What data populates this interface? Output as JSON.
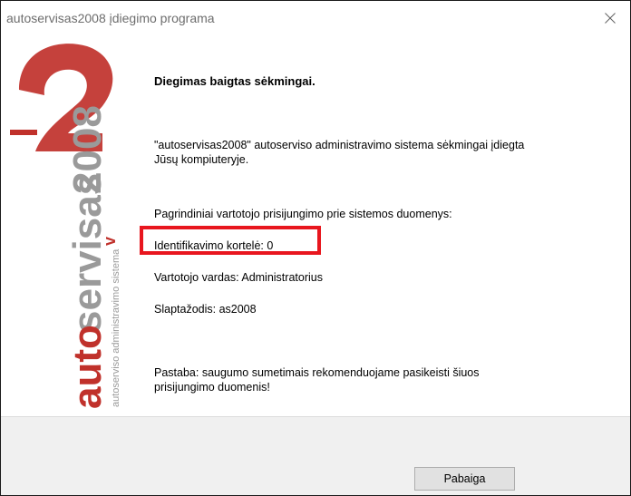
{
  "window": {
    "title": "autoservisas2008 įdiegimo programa"
  },
  "logo": {
    "brand_auto": "auto",
    "brand_servisas": "servisas",
    "brand_year": "2008",
    "subtitle": "autoserviso administravimo sistema",
    "version_mark": "v",
    "colors": {
      "brand_red": "#c0312b",
      "brand_gray": "#9a9a9a"
    }
  },
  "main": {
    "heading": "Diegimas baigtas sėkmingai.",
    "install_line1": "\"autoservisas2008\" autoserviso administravimo sistema sėkmingai įdiegta",
    "install_line2": "Jūsų kompiuteryje.",
    "credentials_intro": "Pagrindiniai vartotojo prisijungimo prie sistemos duomenys:",
    "card_line": "Identifikavimo kortelė: 0",
    "username_line": "Vartotojo vardas: Administratorius",
    "password_line": "Slaptažodis: as2008",
    "note_line1": "Pastaba: saugumo sumetimais rekomenduojame pasikeisti šiuos",
    "note_line2": "prisijungimo duomenis!"
  },
  "footer": {
    "finish_label": "Pabaiga"
  },
  "highlight_color": "#e8161e"
}
